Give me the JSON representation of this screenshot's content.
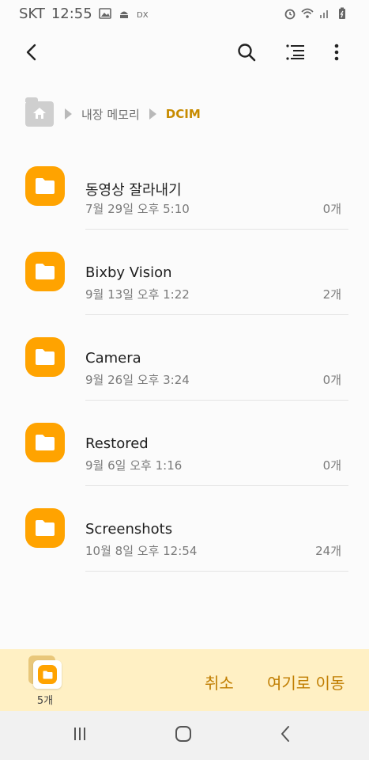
{
  "status_bar": {
    "carrier": "SKT",
    "time": "12:55",
    "left_icons": [
      "image-icon",
      "android-icon",
      "dx-icon"
    ],
    "right_icons": [
      "alarm-icon",
      "wifi-icon",
      "signal-icon",
      "battery-icon"
    ]
  },
  "toolbar": {
    "icons": [
      "back-arrow-icon",
      "search-icon",
      "sort-list-icon",
      "more-vert-icon"
    ]
  },
  "breadcrumb": {
    "items": [
      "내장 메모리",
      "DCIM"
    ]
  },
  "folders": [
    {
      "name": "동영상 잘라내기",
      "date": "7월 29일 오후 5:10",
      "count": "0개"
    },
    {
      "name": "Bixby Vision",
      "date": "9월 13일 오후 1:22",
      "count": "2개"
    },
    {
      "name": "Camera",
      "date": "9월 26일 오후 3:24",
      "count": "0개"
    },
    {
      "name": "Restored",
      "date": "9월 6일 오후 1:16",
      "count": "0개"
    },
    {
      "name": "Screenshots",
      "date": "10월 8일 오후 12:54",
      "count": "24개"
    }
  ],
  "bottom_bar": {
    "selected_count": "5개",
    "cancel_label": "취소",
    "move_label": "여기로 이동"
  },
  "colors": {
    "accent": "#ffa300",
    "accent_text": "#c07d00",
    "bottom_bar_bg": "#fff0c4"
  }
}
